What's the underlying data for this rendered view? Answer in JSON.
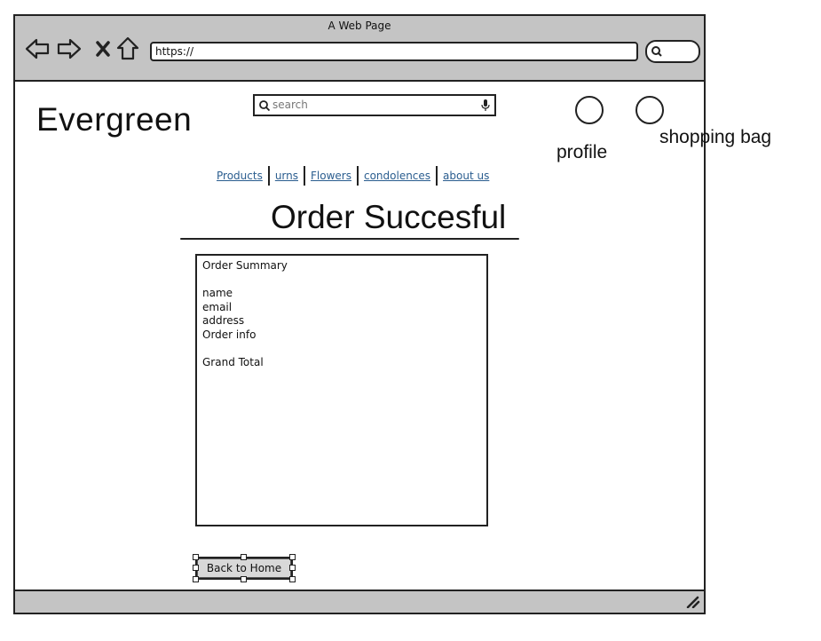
{
  "browser": {
    "window_title": "A Web Page",
    "url": "https://",
    "nav_icons": [
      "back-arrow-icon",
      "forward-arrow-icon",
      "close-x-icon",
      "home-icon"
    ],
    "search_icon": "search-icon",
    "resize_icon": "resize-grip-icon"
  },
  "header": {
    "brand": "Evergreen",
    "search": {
      "placeholder": "search",
      "value": "",
      "left_icon": "search-icon",
      "right_icon": "microphone-icon"
    },
    "profile_label": "profile",
    "bag_label": "shopping bag"
  },
  "nav": {
    "items": [
      {
        "label": "Products"
      },
      {
        "label": "urns"
      },
      {
        "label": "Flowers"
      },
      {
        "label": "condolences"
      },
      {
        "label": "about us"
      }
    ]
  },
  "main": {
    "title": "Order Succesful",
    "summary": {
      "heading": "Order Summary",
      "fields": [
        "name",
        "email",
        "address",
        "Order info"
      ],
      "total_label": "Grand Total"
    },
    "back_button": "Back to Home"
  },
  "colors": {
    "chrome": "#c4c4c4",
    "link": "#2a5d8f",
    "button": "#d8d8d8",
    "outline": "#222222"
  }
}
